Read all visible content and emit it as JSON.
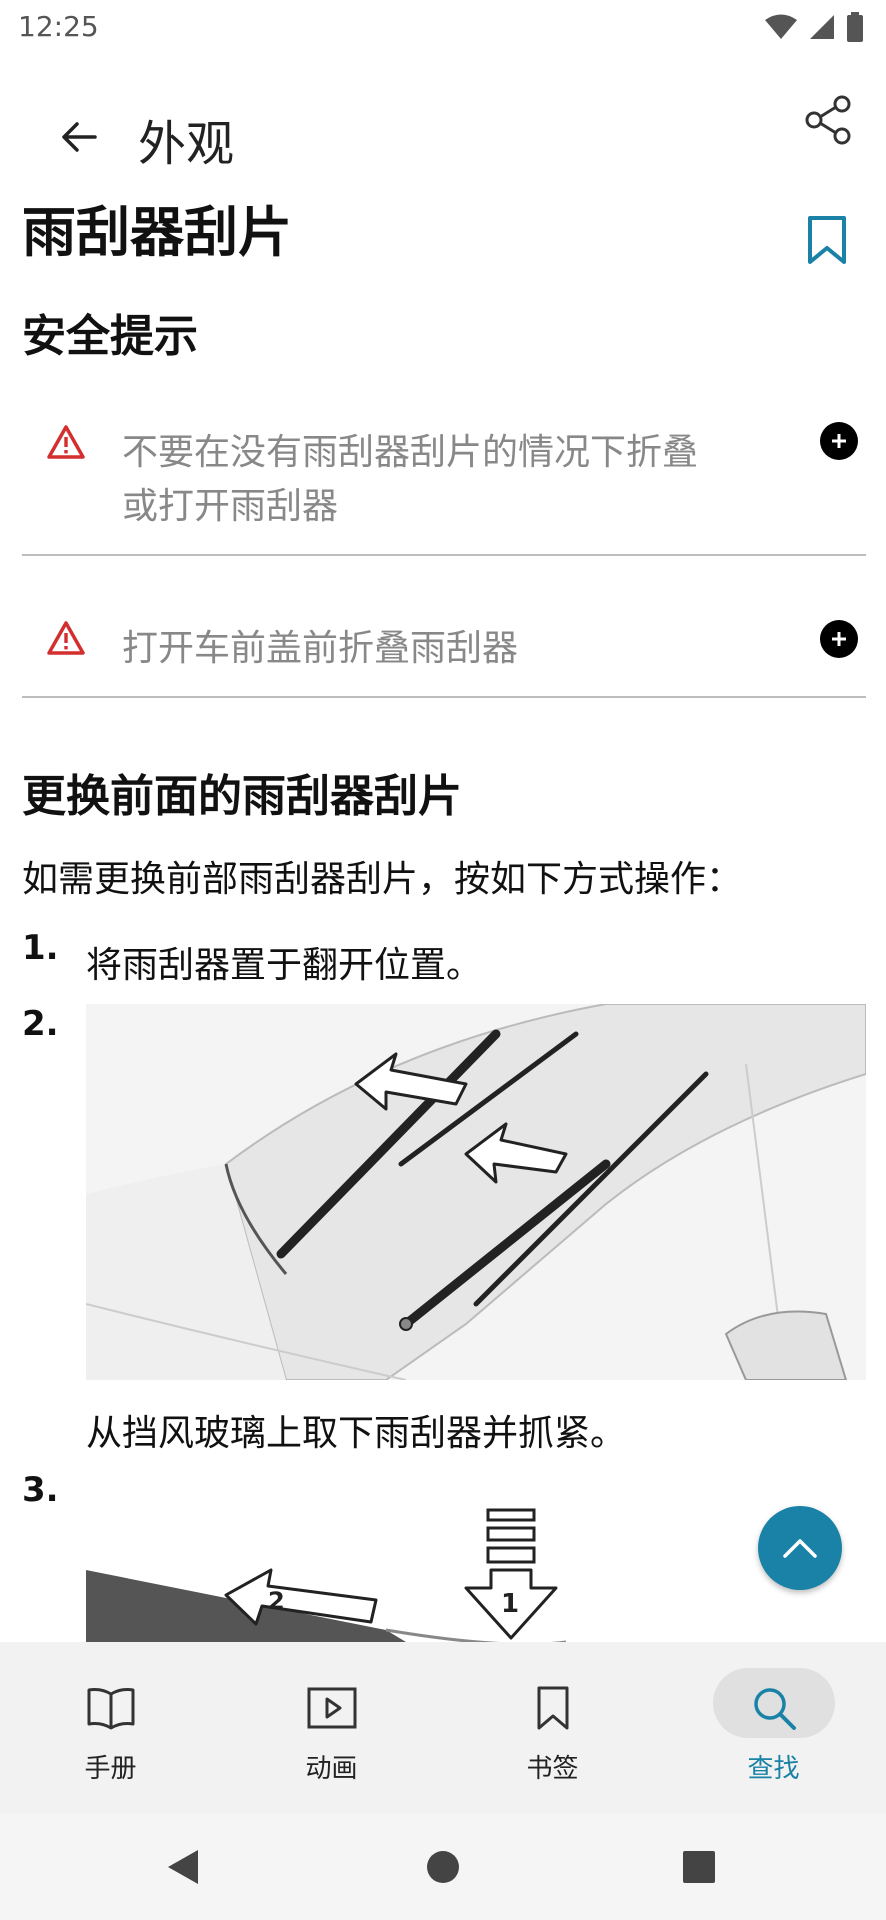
{
  "status": {
    "time": "12:25"
  },
  "header": {
    "back_label": "back",
    "title": "外观"
  },
  "page": {
    "title": "雨刮器刮片"
  },
  "safety": {
    "heading": "安全提示",
    "warnings": [
      {
        "text": "不要在没有雨刮器刮片的情况下折叠或打开雨刮器"
      },
      {
        "text": "打开车前盖前折叠雨刮器"
      }
    ]
  },
  "replace": {
    "heading": "更换前面的雨刮器刮片",
    "intro": "如需更换前部雨刮器刮片，按如下方式操作：",
    "steps": [
      {
        "num": "1.",
        "text": "将雨刮器置于翻开位置。"
      },
      {
        "num": "2.",
        "text": "从挡风玻璃上取下雨刮器并抓紧。"
      },
      {
        "num": "3.",
        "text": ""
      }
    ],
    "step3_markers": [
      "2",
      "1"
    ]
  },
  "bottom_nav": [
    {
      "label": "手册",
      "icon": "book-icon"
    },
    {
      "label": "动画",
      "icon": "play-icon"
    },
    {
      "label": "书签",
      "icon": "bookmark-icon"
    },
    {
      "label": "查找",
      "icon": "search-icon",
      "active": true
    }
  ],
  "colors": {
    "accent": "#1a82a7",
    "warning": "#d32f2f",
    "nav_bg": "#f2f2f2"
  }
}
